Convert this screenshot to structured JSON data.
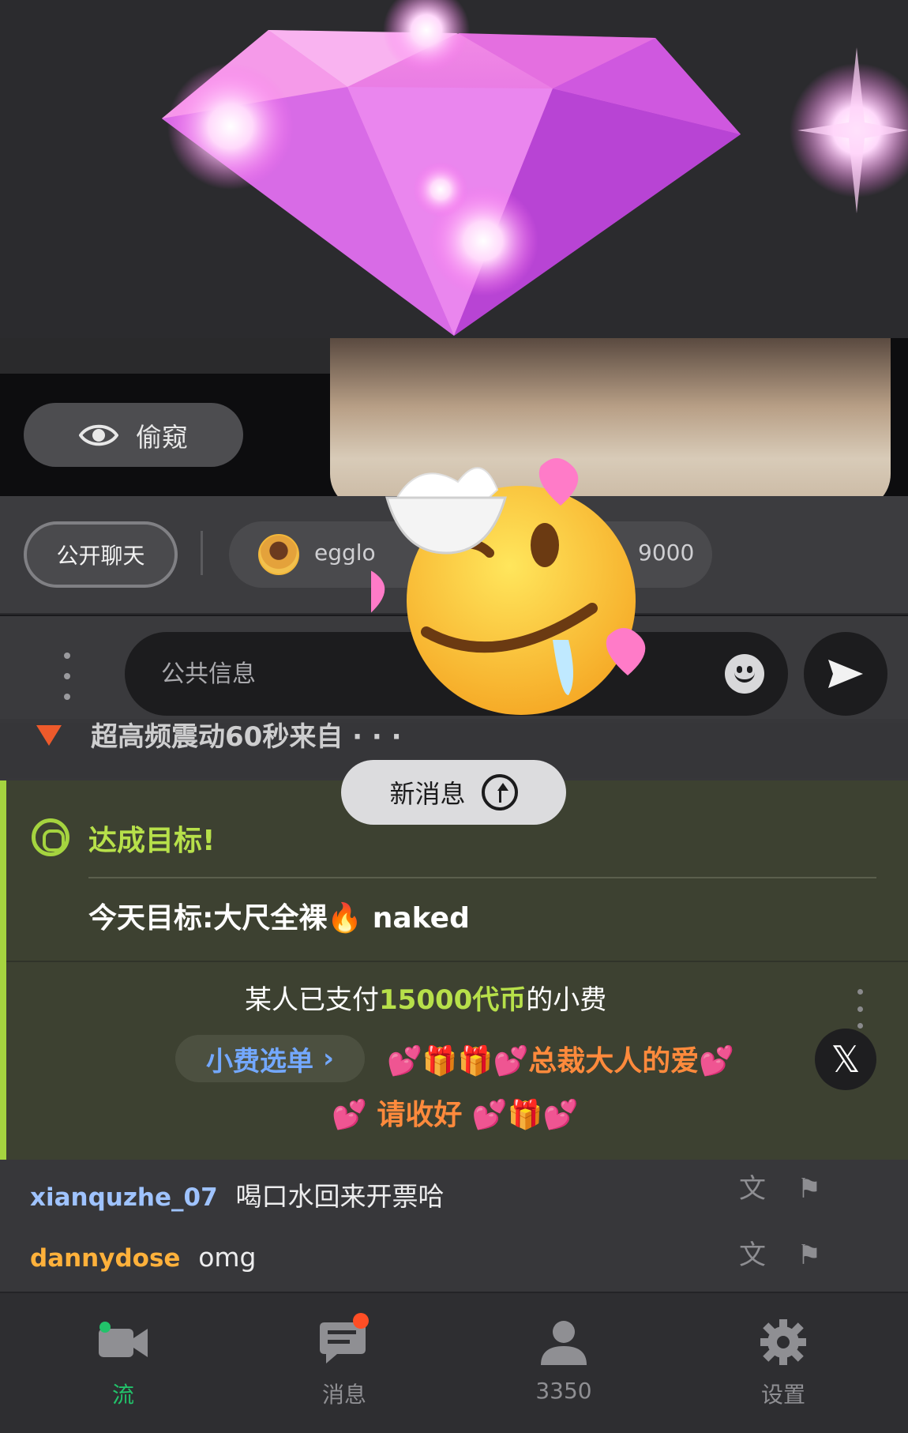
{
  "peek": {
    "label": "偷窥",
    "icon": "eye-icon"
  },
  "tabs": {
    "public_label": "公开聊天",
    "private_user": "egglo",
    "private_count": "9000"
  },
  "composer": {
    "placeholder": "公共信息",
    "emoji_icon": "smiley-icon",
    "send_icon": "send-icon"
  },
  "chat": {
    "cut_off_text": "超高频震动60秒来自 · · ·",
    "new_messages_label": "新消息",
    "goal": {
      "title": "达成目标!",
      "text": "今天目标:大尺全裸🔥 naked"
    },
    "tip": {
      "prefix": "某人已支付",
      "amount": "15000代币",
      "suffix": "的小费",
      "menu_label": "小费选单",
      "note_line1": "💕🎁🎁💕总裁大人的爱💕",
      "note_line2": "💕 请收好 💕🎁💕"
    },
    "messages": [
      {
        "user": "xianquzhe_07",
        "text": "喝口水回来开票哈",
        "user_color": "#9fc3ff"
      },
      {
        "user": "dannydose",
        "text": "omg",
        "user_color": "#ffb13b"
      }
    ]
  },
  "nav": {
    "items": [
      {
        "label": "流",
        "icon": "video-camera-icon",
        "active": true
      },
      {
        "label": "消息",
        "icon": "message-icon",
        "badge": true
      },
      {
        "label": "3350",
        "icon": "person-icon"
      },
      {
        "label": "设置",
        "icon": "gear-icon"
      }
    ]
  },
  "colors": {
    "accent_green": "#a5d43f",
    "nav_active": "#22c26a",
    "tip_text": "#ff8a3c",
    "tip_menu": "#73a8ff"
  }
}
